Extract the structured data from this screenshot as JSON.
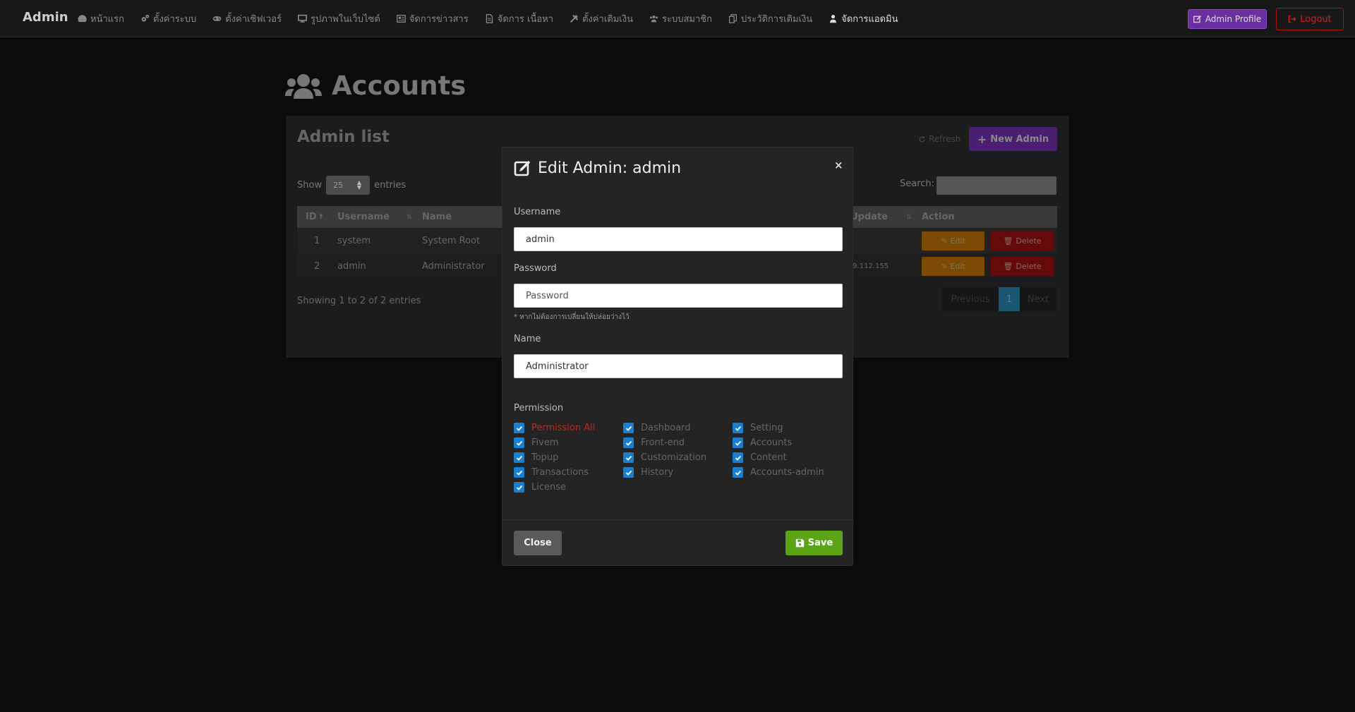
{
  "navbar": {
    "brand": "Admin",
    "items": [
      {
        "label": "หน้าแรก",
        "icon": "dashboard-icon"
      },
      {
        "label": "ตั้งค่าระบบ",
        "icon": "gears-icon"
      },
      {
        "label": "ตั้งค่าเซิฟเวอร์",
        "icon": "gamepad-icon"
      },
      {
        "label": "รูปภาพในเว็บไซต์",
        "icon": "desktop-icon"
      },
      {
        "label": "จัดการข่าวสาร",
        "icon": "newspaper-icon"
      },
      {
        "label": "จัดการ เนื้อหา",
        "icon": "file-icon"
      },
      {
        "label": "ตั้งค่าเติมเงิน",
        "icon": "tools-icon"
      },
      {
        "label": "ระบบสมาชิก",
        "icon": "users-icon"
      },
      {
        "label": "ประวัติการเติมเงิน",
        "icon": "copy-icon"
      },
      {
        "label": "จัดการแอดมิน",
        "icon": "user-shield-icon"
      }
    ],
    "profile_label": "Admin Profile",
    "logout_label": "Logout"
  },
  "page": {
    "title": "Accounts"
  },
  "panel": {
    "title": "Admin list",
    "refresh_label": "Refresh",
    "new_admin_label": "New Admin",
    "show_label": "Show",
    "entries_label": "entries",
    "page_size": "25",
    "search_label": "Search:",
    "columns": {
      "id": "ID",
      "username": "Username",
      "name": "Name",
      "update": "Update",
      "action": "Action"
    },
    "rows": [
      {
        "id": "1",
        "username": "system",
        "name": "System Root",
        "update": ""
      },
      {
        "id": "2",
        "username": "admin",
        "name": "Administrator",
        "update": ".9.112.155"
      }
    ],
    "edit_label": "Edit",
    "delete_label": "Delete",
    "showing_text": "Showing 1 to 2 of 2 entries",
    "pager": {
      "previous": "Previous",
      "current": "1",
      "next": "Next"
    }
  },
  "modal": {
    "title": "Edit Admin: admin",
    "close_symbol": "×",
    "username_label": "Username",
    "username_value": "admin",
    "password_label": "Password",
    "password_placeholder": "Password",
    "password_hint": "* หากไม่ต้องการเปลี่ยนให้ปล่อยว่างไว้",
    "name_label": "Name",
    "name_value": "Administrator",
    "permission_label": "Permission",
    "permissions": [
      {
        "label": "Permission All",
        "checked": true
      },
      {
        "label": "Dashboard",
        "checked": true
      },
      {
        "label": "Setting",
        "checked": true
      },
      {
        "label": "Fivem",
        "checked": true
      },
      {
        "label": "Front-end",
        "checked": true
      },
      {
        "label": "Accounts",
        "checked": true
      },
      {
        "label": "Topup",
        "checked": true
      },
      {
        "label": "Customization",
        "checked": true
      },
      {
        "label": "Content",
        "checked": true
      },
      {
        "label": "Transactions",
        "checked": true
      },
      {
        "label": "History",
        "checked": true
      },
      {
        "label": "Accounts-admin",
        "checked": true
      },
      {
        "label": "License",
        "checked": true
      }
    ],
    "close_label": "Close",
    "save_label": "Save"
  },
  "colors": {
    "accent_purple": "#6a2fa0",
    "danger": "#c22222",
    "save_green": "#5ca417",
    "checkbox_blue": "#1a7fcf"
  }
}
